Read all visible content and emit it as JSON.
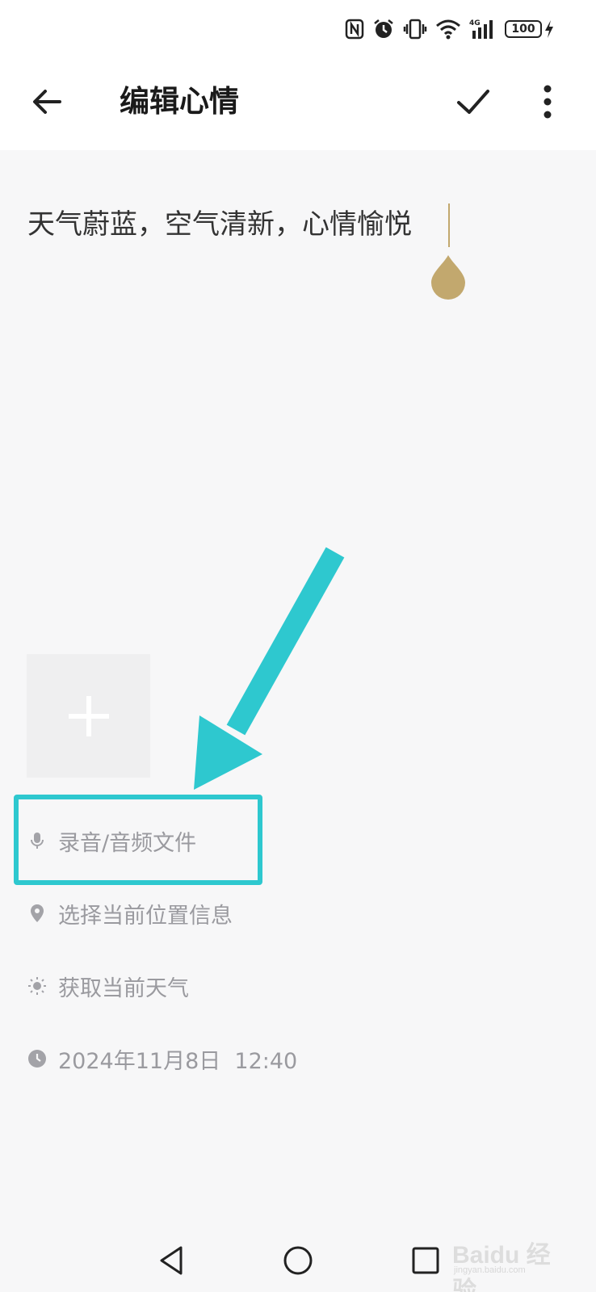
{
  "status_bar": {
    "network_label": "4G",
    "battery_level": "100"
  },
  "header": {
    "title": "编辑心情"
  },
  "editor": {
    "text": "天气蔚蓝，空气清新，心情愉悦"
  },
  "meta": {
    "audio_label": "录音/音频文件",
    "location_label": "选择当前位置信息",
    "weather_label": "获取当前天气",
    "datetime_label": "2024年11月8日  12:40"
  },
  "watermark": {
    "brand": "Baidu 经验",
    "sub": "jingyan.baidu.com"
  },
  "colors": {
    "highlight": "#2ec8cf",
    "cursor": "#c2a86e",
    "meta_text": "#9a9a9f",
    "background": "#f7f7f8"
  }
}
